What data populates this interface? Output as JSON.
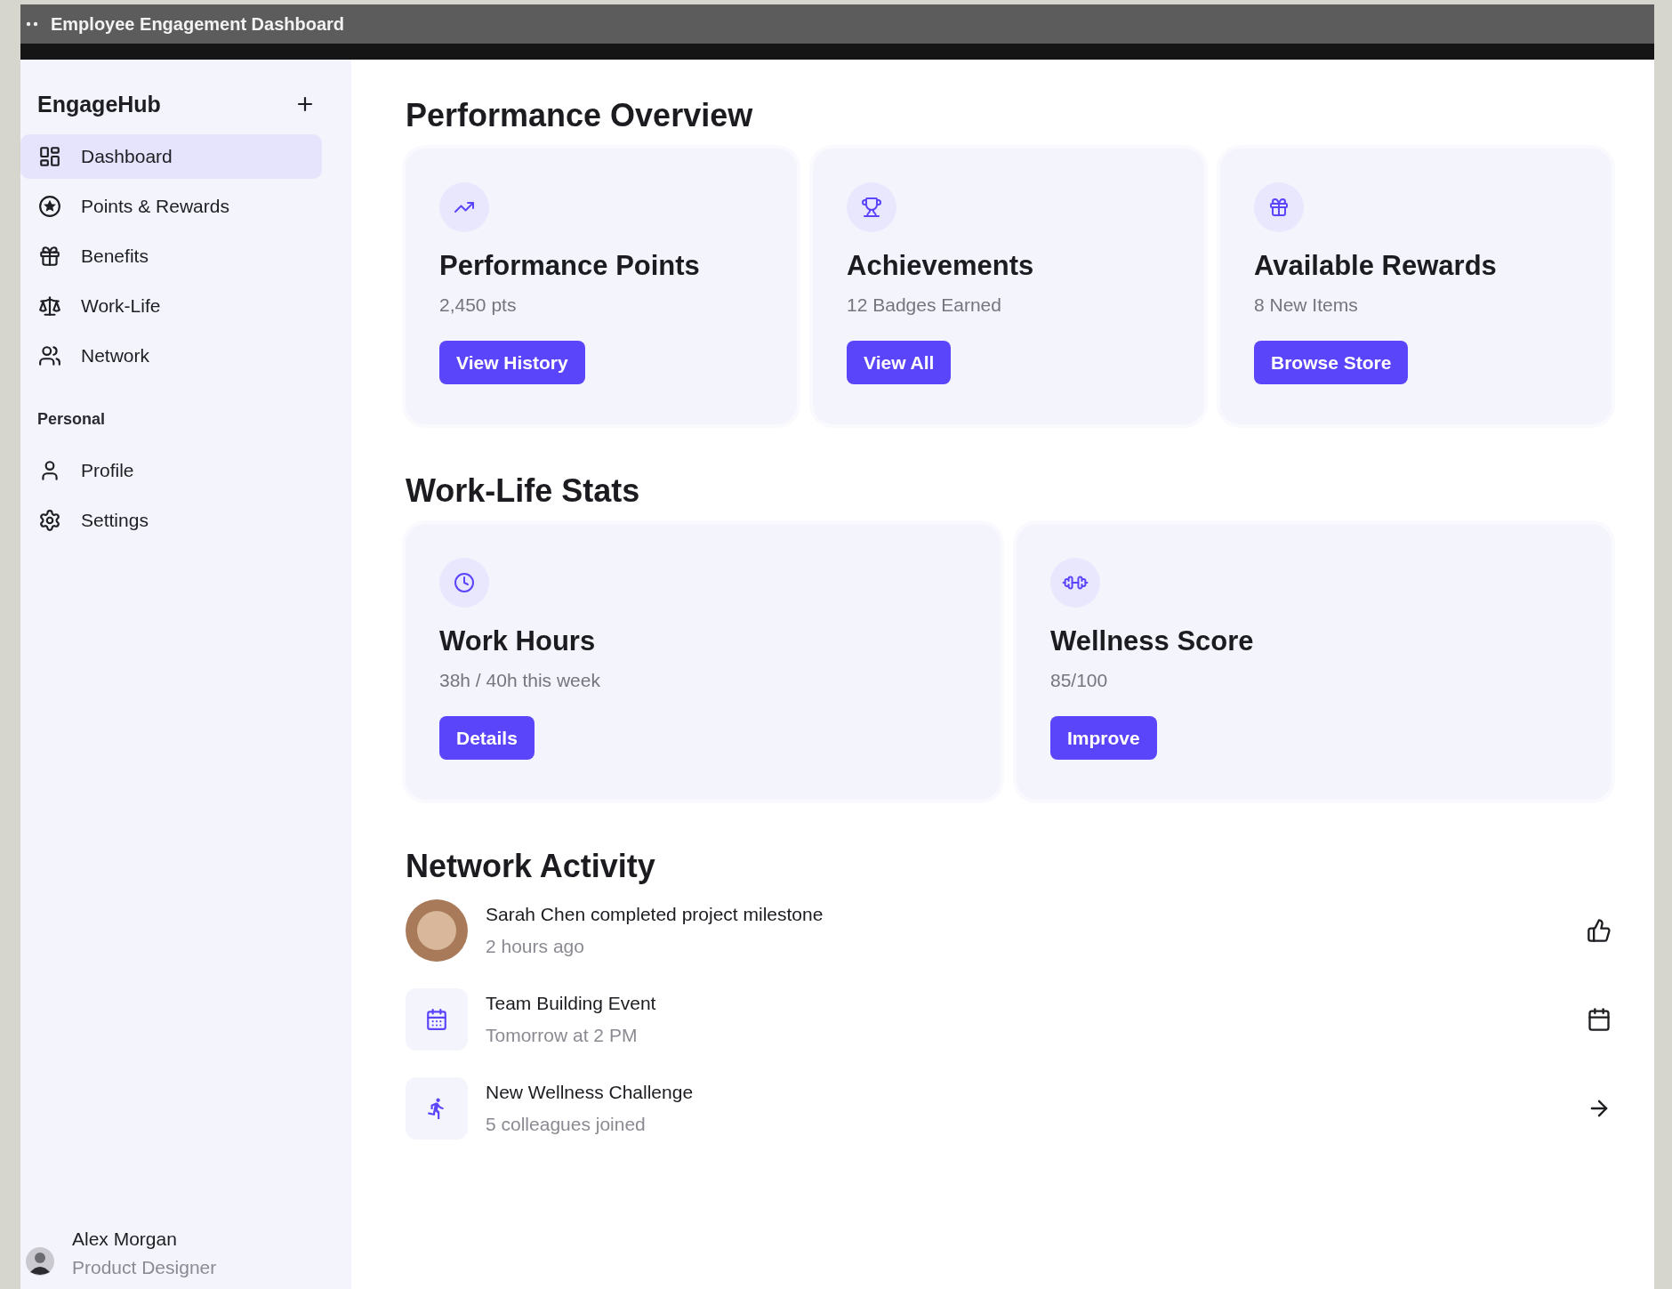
{
  "window": {
    "title": "Employee Engagement Dashboard"
  },
  "sidebar": {
    "brand": "EngageHub",
    "nav": [
      {
        "label": "Dashboard",
        "selected": true
      },
      {
        "label": "Points & Rewards",
        "selected": false
      },
      {
        "label": "Benefits",
        "selected": false
      },
      {
        "label": "Work-Life",
        "selected": false
      },
      {
        "label": "Network",
        "selected": false
      }
    ],
    "section_label": "Personal",
    "personal": [
      {
        "label": "Profile",
        "selected": false
      },
      {
        "label": "Settings",
        "selected": false
      }
    ],
    "user": {
      "name": "Alex Morgan",
      "role": "Product Designer"
    }
  },
  "performance_overview": {
    "title": "Performance Overview",
    "cards": [
      {
        "title": "Performance Points",
        "value": "2,450 pts",
        "button": "View History"
      },
      {
        "title": "Achievements",
        "value": "12 Badges Earned",
        "button": "View All"
      },
      {
        "title": "Available Rewards",
        "value": "8 New Items",
        "button": "Browse Store"
      }
    ]
  },
  "work_life_stats": {
    "title": "Work-Life Stats",
    "cards": [
      {
        "title": "Work Hours",
        "value": "38h / 40h this week",
        "button": "Details"
      },
      {
        "title": "Wellness Score",
        "value": "85/100",
        "button": "Improve"
      }
    ]
  },
  "network_activity": {
    "title": "Network Activity",
    "items": [
      {
        "kind": "person",
        "title": "Sarah Chen completed project milestone",
        "subtitle": "2 hours ago"
      },
      {
        "kind": "event",
        "title": "Team Building Event",
        "subtitle": "Tomorrow at 2 PM"
      },
      {
        "kind": "challenge",
        "title": "New Wellness Challenge",
        "subtitle": "5 colleagues joined"
      }
    ]
  }
}
